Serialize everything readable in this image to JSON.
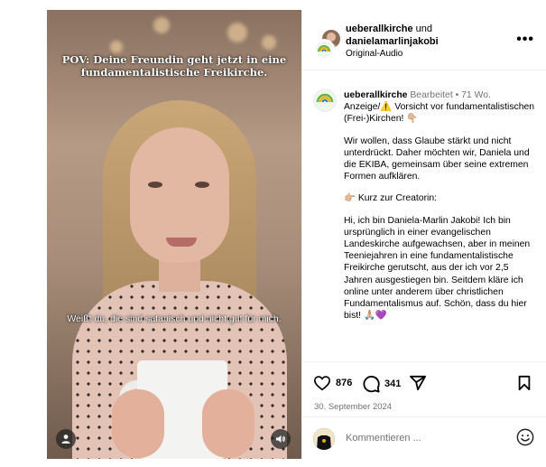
{
  "media": {
    "overlay_title": "POV: Deine Freundin geht jetzt in eine fundamentalistische Freikirche.",
    "caption": "Weißt du, die sind satanisch und nicht gut für mich."
  },
  "header": {
    "account1": "ueberallkirche",
    "joiner": " und",
    "account2": "danielamarlinjakobi",
    "audio": "Original-Audio",
    "more_label": "•••"
  },
  "caption": {
    "username": "ueberallkirche",
    "edited": "Bearbeitet",
    "dot": "•",
    "age": "71 Wo.",
    "line1": "Anzeige/⚠️ Vorsicht vor fundamentalistischen (Frei-)Kirchen! 👇🏼",
    "para2": "Wir wollen, dass Glaube stärkt und nicht unterdrückt. Daher möchten wir, Daniela und die EKIBA, gemeinsam über seine extremen Formen aufklären.",
    "para3": "👉🏼 Kurz zur Creatorin:",
    "para4": "Hi, ich bin Daniela-Marlin Jakobi! Ich bin ursprünglich in einer evangelischen Landeskirche aufgewachsen, aber in meinen Teeniejahren in eine fundamentalistische Freikirche gerutscht, aus der ich vor 2,5 Jahren ausgestiegen bin. Seitdem kläre ich online unter anderem über christlichen Fundamentalismus auf. Schön, dass du hier bist! 🙏🏼💜"
  },
  "actions": {
    "likes": "876",
    "comments": "341",
    "date": "30. September 2024"
  },
  "comment_box": {
    "placeholder": "Kommentieren ..."
  },
  "icons": {
    "like": "heart-icon",
    "comment": "comment-icon",
    "share": "share-icon",
    "save": "bookmark-icon",
    "emoji": "emoji-icon",
    "user_tag": "user-tag-icon",
    "audio": "speaker-icon"
  }
}
